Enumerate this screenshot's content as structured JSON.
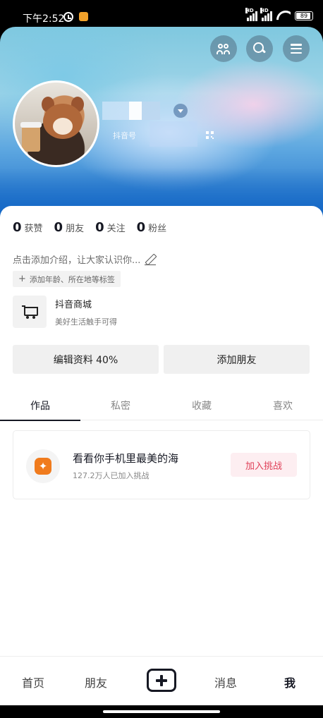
{
  "status_bar": {
    "time": "下午2:52",
    "battery": "89",
    "signal_label": "HD"
  },
  "profile": {
    "douyin_id_label": "抖音号",
    "bio_placeholder": "点击添加介绍，让大家认识你...",
    "tag_hint": "添加年龄、所在地等标签"
  },
  "stats": [
    {
      "num": "0",
      "label": "获赞"
    },
    {
      "num": "0",
      "label": "朋友"
    },
    {
      "num": "0",
      "label": "关注"
    },
    {
      "num": "0",
      "label": "粉丝"
    }
  ],
  "shop": {
    "title": "抖音商城",
    "subtitle": "美好生活触手可得"
  },
  "actions": {
    "edit_profile": "编辑资料 40%",
    "add_friend": "添加朋友"
  },
  "tabs": [
    "作品",
    "私密",
    "收藏",
    "喜欢"
  ],
  "challenge": {
    "title": "看看你手机里最美的海",
    "subtitle": "127.2万人已加入挑战",
    "button": "加入挑战"
  },
  "bottom_nav": {
    "home": "首页",
    "friends": "朋友",
    "messages": "消息",
    "me": "我"
  }
}
